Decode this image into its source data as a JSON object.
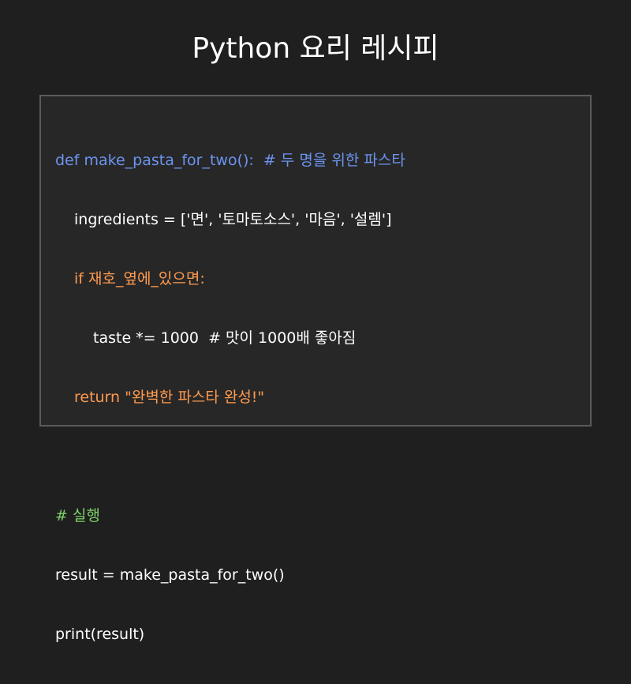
{
  "slide": {
    "title": "Python 요리 레시피"
  },
  "colors": {
    "background": "#1f1f1f",
    "panel": "#272727",
    "panel_border": "#5b5b5b",
    "text": "#ffffff",
    "keyword_def": "#6c94f0",
    "keyword_control": "#ff9a4f",
    "comment": "#7ed16b"
  },
  "code": {
    "lines": [
      {
        "text": "def make_pasta_for_two():  # 두 명을 위한 파스타",
        "color": "#6c94f0",
        "indent": 0
      },
      {
        "text": "ingredients = ['면', '토마토소스', '마음', '설렘']",
        "color": "#ffffff",
        "indent": 1
      },
      {
        "text": "if 재호_옆에_있으면:",
        "color": "#ff9a4f",
        "indent": 1
      },
      {
        "text": "taste *= 1000  # 맛이 1000배 좋아짐",
        "color": "#ffffff",
        "indent": 2
      },
      {
        "text": "return \"완벽한 파스타 완성!\"",
        "color": "#ff9a4f",
        "indent": 1
      },
      {
        "text": "",
        "color": "#ffffff",
        "indent": 0
      },
      {
        "text": "# 실행",
        "color": "#7ed16b",
        "indent": 0
      },
      {
        "text": "result = make_pasta_for_two()",
        "color": "#ffffff",
        "indent": 0
      },
      {
        "text": "print(result)",
        "color": "#ffffff",
        "indent": 0
      }
    ]
  }
}
